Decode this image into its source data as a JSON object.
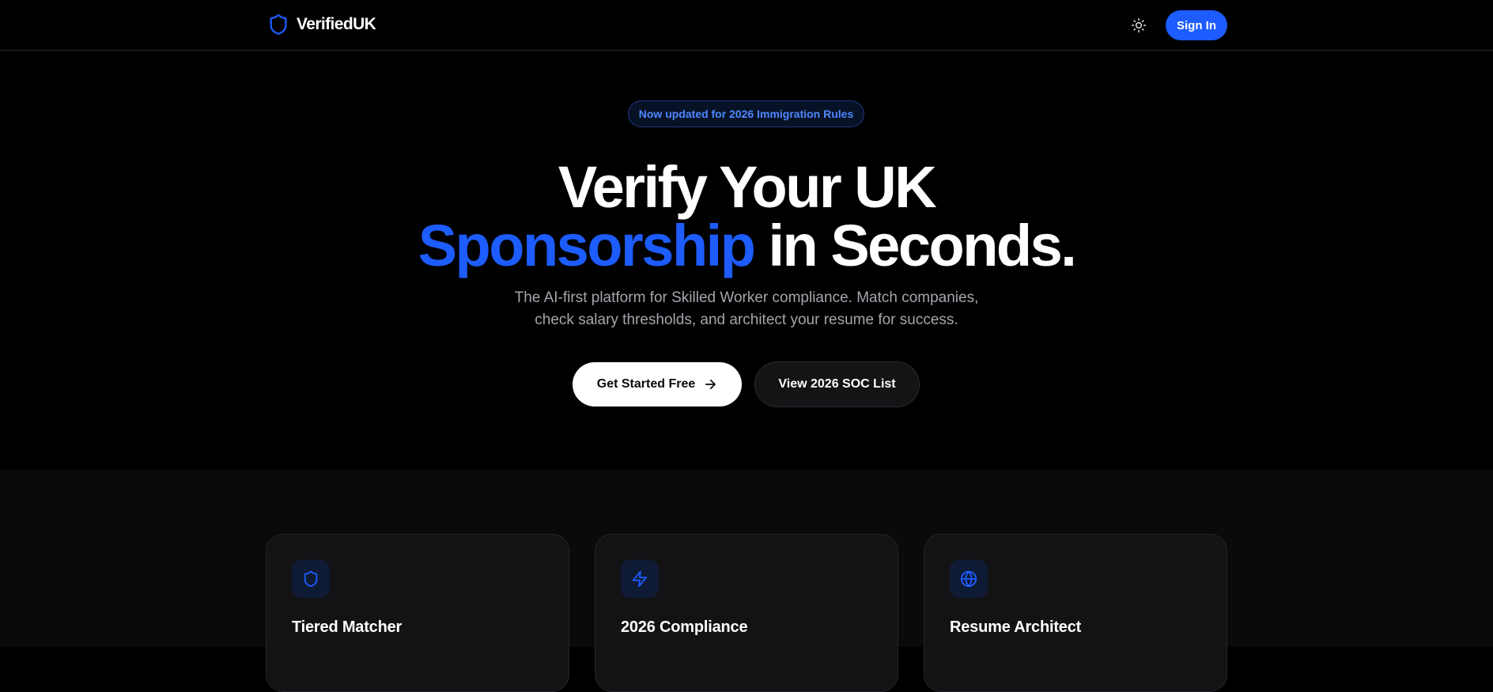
{
  "nav": {
    "brand_name": "VerifiedUK",
    "brand_icon": "shield-icon",
    "theme_icon": "sun-icon",
    "signin_label": "Sign In"
  },
  "hero": {
    "badge": "Now updated for 2026 Immigration Rules",
    "headline_line1": "Verify Your UK",
    "headline_accent": "Sponsorship",
    "headline_rest": " in Seconds.",
    "subtitle_line1": "The AI-first platform for Skilled Worker compliance. Match companies,",
    "subtitle_line2": "check salary thresholds, and architect your resume for success.",
    "cta_primary": "Get Started Free",
    "cta_primary_icon": "arrow-right-icon",
    "cta_secondary": "View 2026 SOC List"
  },
  "features": [
    {
      "title": "Tiered Matcher",
      "icon": "shield-icon"
    },
    {
      "title": "2026 Compliance",
      "icon": "lightning-icon"
    },
    {
      "title": "Resume Architect",
      "icon": "globe-icon"
    }
  ],
  "colors": {
    "background": "#000000",
    "accent": "#1d5cff",
    "badge_text": "#4d88ff",
    "muted_text": "#a3a6ad",
    "card_background": "#131316"
  }
}
